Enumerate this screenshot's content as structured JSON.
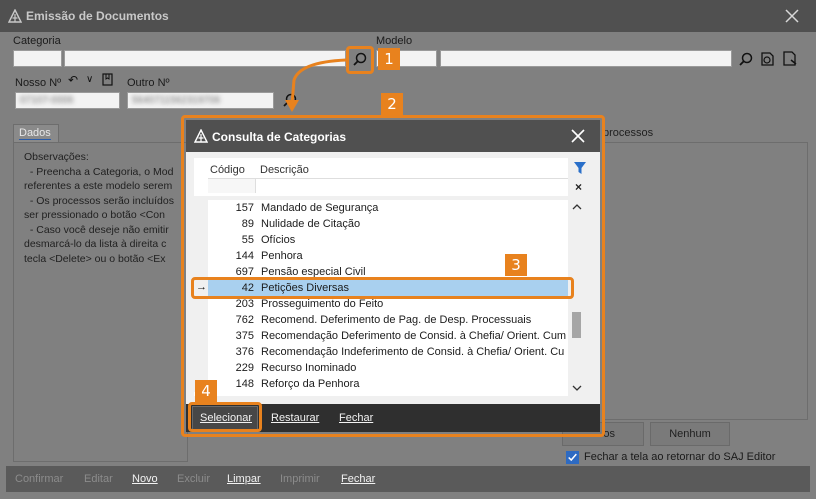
{
  "window": {
    "title": "Emissão de Documentos"
  },
  "fields": {
    "categoria_label": "Categoria",
    "modelo_label": "Modelo",
    "nosso_label": "Nosso Nº",
    "outro_label": "Outro Nº",
    "nosso_value": "07107-0006",
    "outro_value": "5640711562319706"
  },
  "tabs": {
    "dados": "Dados",
    "processos_label": "processos"
  },
  "observacoes": {
    "text": "Observações:\n  - Preencha a Categoria, o Mod\nreferentes a este modelo serem\n  - Os processos serão incluídos\nser pressionado o botão <Con\n  - Caso você deseje não emitir\ndesmarcá-lo da lista à direita c\ntecla <Delete> ou o botão <Ex"
  },
  "right_panel": {
    "btn_todos": "os",
    "btn_nenhum": "Nenhum",
    "checkbox_label": "Fechar a tela ao retornar do SAJ Editor"
  },
  "bottombar": {
    "confirmar": "Confirmar",
    "editar": "Editar",
    "novo": "Novo",
    "excluir": "Excluir",
    "limpar": "Limpar",
    "imprimir": "Imprimir",
    "fechar": "Fechar"
  },
  "dialog": {
    "title": "Consulta de Categorias",
    "col_codigo": "Código",
    "col_descricao": "Descrição",
    "rows": [
      {
        "code": "157",
        "desc": "Mandado de Segurança"
      },
      {
        "code": "89",
        "desc": "Nulidade de Citação"
      },
      {
        "code": "55",
        "desc": "Ofícios"
      },
      {
        "code": "144",
        "desc": "Penhora"
      },
      {
        "code": "697",
        "desc": "Pensão especial Civil"
      },
      {
        "code": "42",
        "desc": "Petições Diversas"
      },
      {
        "code": "203",
        "desc": "Prosseguimento do Feito"
      },
      {
        "code": "762",
        "desc": "Recomend. Deferimento de Pag. de Desp. Processuais"
      },
      {
        "code": "375",
        "desc": "Recomendação Deferimento de Consid. à Chefia/ Orient. Cum"
      },
      {
        "code": "376",
        "desc": "Recomendação Indeferimento de Consid. à Chefia/ Orient. Cu"
      },
      {
        "code": "229",
        "desc": "Recurso Inominado"
      },
      {
        "code": "148",
        "desc": "Reforço da Penhora"
      }
    ],
    "selected_row": 5,
    "footer": {
      "selecionar": "Selecionar",
      "restaurar": "Restaurar",
      "fechar": "Fechar"
    }
  },
  "callouts": {
    "c1": "1",
    "c2": "2",
    "c3": "3",
    "c4": "4"
  },
  "colors": {
    "accent": "#e8821e",
    "selection": "#a9d0ef",
    "checkbox": "#2d6ac2"
  }
}
